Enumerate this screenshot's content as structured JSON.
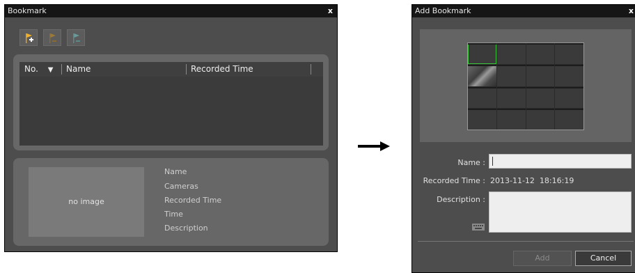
{
  "bookmark_window": {
    "title": "Bookmark",
    "close": "x",
    "toolbar": [
      {
        "icon": "bookmark-add-icon"
      },
      {
        "icon": "bookmark-edit-icon"
      },
      {
        "icon": "bookmark-delete-icon"
      }
    ],
    "list": {
      "columns": [
        "No.",
        "Name",
        "Recorded Time"
      ],
      "sort_indicator": "▼",
      "rows": []
    },
    "preview": {
      "placeholder": "no image",
      "labels": [
        "Name",
        "Cameras",
        "Recorded Time",
        "Time",
        "Description"
      ]
    }
  },
  "arrow": "arrow-right-icon",
  "add_window": {
    "title": "Add Bookmark",
    "close": "x",
    "name_label": "Name :",
    "name_value": "",
    "recorded_time_label": "Recorded Time :",
    "recorded_time_value": "2013-11-12  18:16:19",
    "description_label": "Description :",
    "description_value": "",
    "keyboard_icon": "keyboard-icon",
    "add_button": "Add",
    "cancel_button": "Cancel"
  }
}
